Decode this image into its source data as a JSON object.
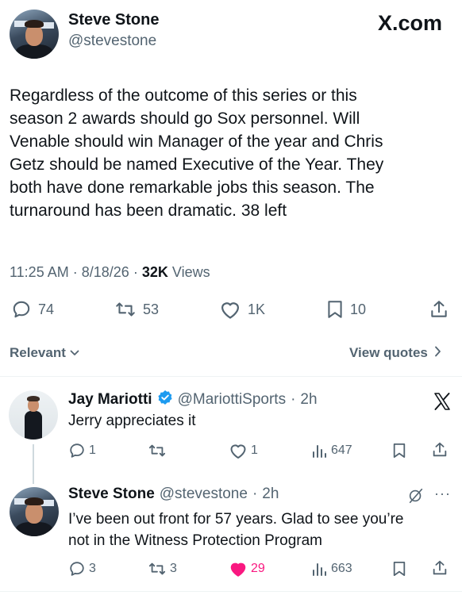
{
  "brand": {
    "logo_text": "X.com"
  },
  "tweet": {
    "author_name": "Steve Stone",
    "author_handle": "@stevestone",
    "text_lines": [
      "Regardless of the outcome of this series or this",
      "season 2 awards should go Sox personnel. Will",
      "Venable should win Manager of the year and Chris",
      "Getz should be named Executive of the Year. They",
      "both have done remarkable jobs this season. The",
      "turnaround has been dramatic. 38 left"
    ],
    "time": "11:25 AM",
    "date": "8/18/26",
    "views_count": "32K",
    "views_label": "Views",
    "replies": "74",
    "reposts": "53",
    "likes": "1K",
    "bookmarks": "10"
  },
  "sort_bar": {
    "relevant_label": "Relevant",
    "view_quotes_label": "View quotes"
  },
  "replies": [
    {
      "author_name": "Jay Mariotti",
      "author_handle": "@MariottiSports",
      "age": "2h",
      "text": "Jerry appreciates it",
      "replies": "1",
      "reposts": "",
      "likes": "1",
      "views": "647"
    },
    {
      "author_name": "Steve Stone",
      "author_handle": "@stevestone",
      "age": "2h",
      "text_lines": [
        "I’ve been out front for 57 years. Glad to see you’re",
        "not in the Witness Protection Program"
      ],
      "replies": "3",
      "reposts": "3",
      "likes": "29",
      "views": "663"
    }
  ],
  "colors": {
    "accent": "#1d9bf0",
    "like_active": "#f91880",
    "muted": "#536471"
  }
}
